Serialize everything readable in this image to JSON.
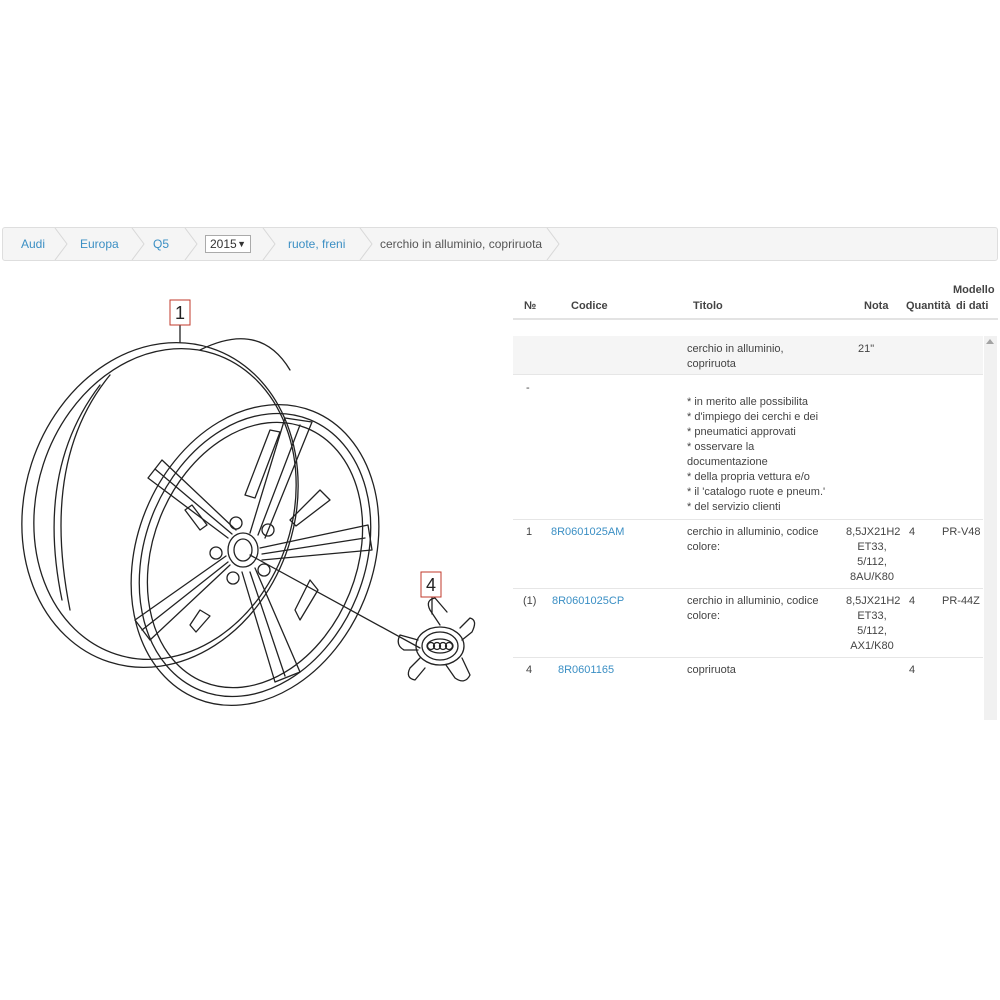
{
  "breadcrumb": {
    "items": [
      "Audi",
      "Europa",
      "Q5"
    ],
    "year": "2015",
    "group": "ruote, freni",
    "current": "cerchio in alluminio, copriruota"
  },
  "diagram": {
    "callouts": [
      "1",
      "4"
    ]
  },
  "table": {
    "headers": {
      "num": "№",
      "code": "Codice",
      "title": "Titolo",
      "note": "Nota",
      "qty": "Quantità",
      "model_line1": "Modello",
      "model_line2": "di dati"
    },
    "rows": [
      {
        "num": "",
        "code": "",
        "title": [
          "cerchio in alluminio,",
          "copriruota"
        ],
        "note": [
          "21\""
        ],
        "qty": "",
        "model": ""
      },
      {
        "num": "-",
        "code": "",
        "title": [
          "* in merito alle possibilita",
          "* d'impiego dei cerchi e dei",
          "* pneumatici approvati",
          "* osservare la",
          "documentazione",
          "* della propria vettura e/o",
          "* il 'catalogo ruote e pneum.'",
          "* del servizio clienti"
        ],
        "note": [],
        "qty": "",
        "model": ""
      },
      {
        "num": "1",
        "code": "8R0601025AM",
        "title": [
          "cerchio in alluminio, codice",
          "colore:"
        ],
        "note": [
          "8,5JX21H2",
          "ET33,",
          "5/112,",
          "8AU/K80"
        ],
        "qty": "4",
        "model": "PR-V48"
      },
      {
        "num": "(1)",
        "code": "8R0601025CP",
        "title": [
          "cerchio in alluminio, codice",
          "colore:"
        ],
        "note": [
          "8,5JX21H2",
          "ET33,",
          "5/112,",
          "AX1/K80"
        ],
        "qty": "4",
        "model": "PR-44Z"
      },
      {
        "num": "4",
        "code": "8R0601165",
        "title": [
          "copriruota"
        ],
        "note": [],
        "qty": "4",
        "model": ""
      }
    ]
  }
}
